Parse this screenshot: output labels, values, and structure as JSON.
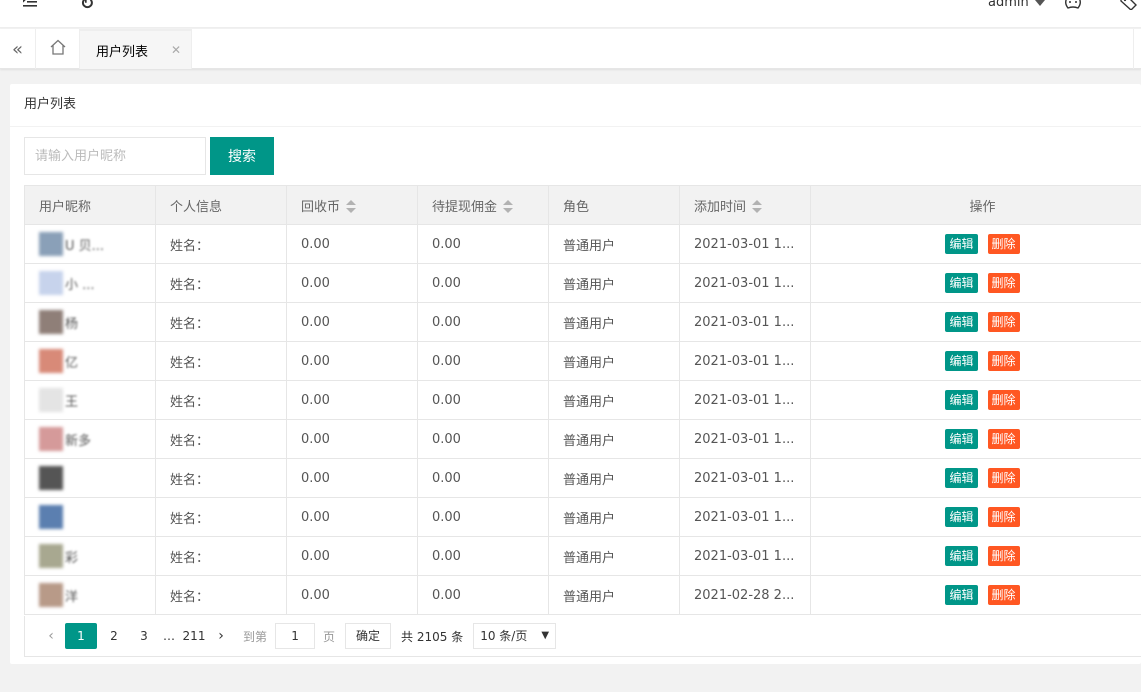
{
  "topbar": {
    "menu_icon": "menu-fold-icon",
    "refresh_icon": "refresh-icon",
    "user_name": "admin",
    "theme_icon": "theme-palette-icon",
    "tag_icon": "tag-icon"
  },
  "tabs": {
    "home_icon": "home-icon",
    "items": [
      {
        "label": "用户列表"
      }
    ]
  },
  "card": {
    "title": "用户列表"
  },
  "search": {
    "placeholder": "请输入用户昵称",
    "button_label": "搜索"
  },
  "table": {
    "columns": [
      "用户昵称",
      "个人信息",
      "回收币",
      "待提现佣金",
      "角色",
      "添加时间",
      "操作"
    ],
    "sortable": [
      false,
      false,
      true,
      true,
      false,
      true,
      false
    ],
    "rows": [
      {
        "nickname": "U 贝...",
        "info": "姓名：",
        "coins": "0.00",
        "commission": "0.00",
        "role": "普通用户",
        "added": "2021-03-01 1...",
        "avatar_color": "#8aa0b8"
      },
      {
        "nickname": "小 ...",
        "info": "姓名：",
        "coins": "0.00",
        "commission": "0.00",
        "role": "普通用户",
        "added": "2021-03-01 1...",
        "avatar_color": "#c7d3ec"
      },
      {
        "nickname": "杨",
        "info": "姓名：",
        "coins": "0.00",
        "commission": "0.00",
        "role": "普通用户",
        "added": "2021-03-01 1...",
        "avatar_color": "#8f7f78"
      },
      {
        "nickname": "亿",
        "info": "姓名：",
        "coins": "0.00",
        "commission": "0.00",
        "role": "普通用户",
        "added": "2021-03-01 1...",
        "avatar_color": "#d88a78"
      },
      {
        "nickname": "王",
        "info": "姓名：",
        "coins": "0.00",
        "commission": "0.00",
        "role": "普通用户",
        "added": "2021-03-01 1...",
        "avatar_color": "#e4e4e4"
      },
      {
        "nickname": "新多",
        "info": "姓名：",
        "coins": "0.00",
        "commission": "0.00",
        "role": "普通用户",
        "added": "2021-03-01 1...",
        "avatar_color": "#d59a9a"
      },
      {
        "nickname": "",
        "info": "姓名：",
        "coins": "0.00",
        "commission": "0.00",
        "role": "普通用户",
        "added": "2021-03-01 1...",
        "avatar_color": "#555555"
      },
      {
        "nickname": "",
        "info": "姓名：",
        "coins": "0.00",
        "commission": "0.00",
        "role": "普通用户",
        "added": "2021-03-01 1...",
        "avatar_color": "#5b7fb0"
      },
      {
        "nickname": "彩",
        "info": "姓名：",
        "coins": "0.00",
        "commission": "0.00",
        "role": "普通用户",
        "added": "2021-03-01 1...",
        "avatar_color": "#a8a890"
      },
      {
        "nickname": "洋",
        "info": "姓名：",
        "coins": "0.00",
        "commission": "0.00",
        "role": "普通用户",
        "added": "2021-02-28 2...",
        "avatar_color": "#b89a88"
      }
    ],
    "edit_label": "编辑",
    "delete_label": "删除"
  },
  "pagination": {
    "pages": [
      "1",
      "2",
      "3"
    ],
    "ellipsis": "…",
    "last_page": "211",
    "goto_label": "到第",
    "goto_value": "1",
    "page_unit": "页",
    "confirm_label": "确定",
    "total_text": "共 2105 条",
    "page_size": "10 条/页"
  },
  "colors": {
    "primary": "#009688",
    "danger": "#ff5722"
  }
}
